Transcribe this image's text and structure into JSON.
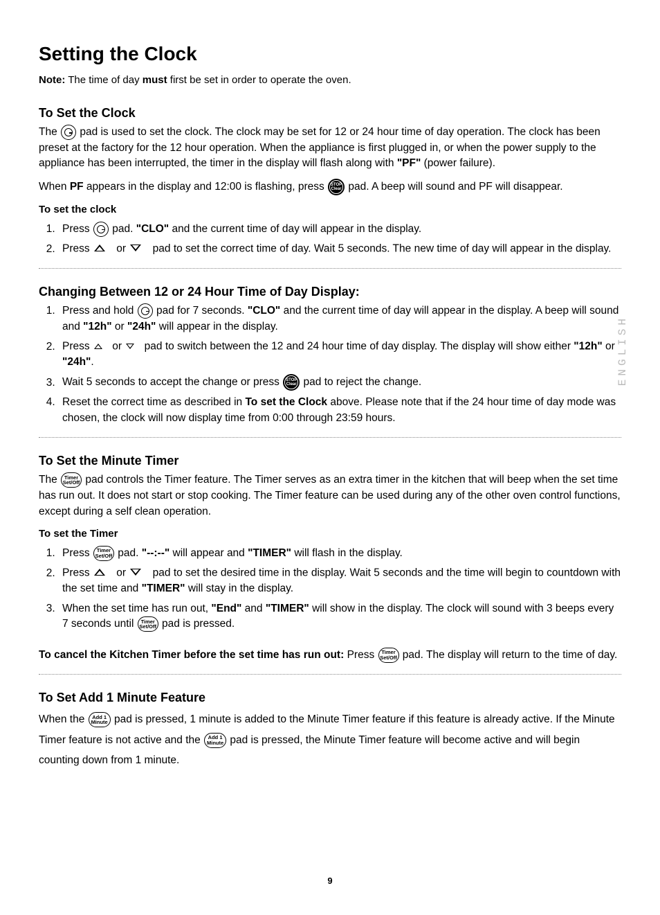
{
  "title": "Setting the Clock",
  "note_label": "Note:",
  "note_body_1": " The time of day ",
  "note_bold": "must",
  "note_body_2": " first be set in order to operate the oven.",
  "s1": {
    "heading": "To Set the Clock",
    "p1a": "The ",
    "p1b": " pad is used to set the clock. The clock may be set for 12 or 24 hour time of day operation. The clock has been preset at the factory for the 12 hour operation. When the appliance is first plugged in, or when the power supply to the appliance has been interrupted, the timer in the display will flash along with ",
    "p1c": "\"PF\"",
    "p1d": " (power failure).",
    "p2a": "When ",
    "p2b": "PF",
    "p2c": " appears in the display and 12:00 is flashing, press ",
    "p2d": " pad. A beep will sound and PF will disappear.",
    "sub": "To set the clock",
    "li1a": "Press ",
    "li1b": " pad. ",
    "li1c": "\"CLO\"",
    "li1d": " and the current time of day will appear in the display.",
    "li2a": "Press ",
    "li2b": " or ",
    "li2c": " pad to set the correct time of day. Wait 5 seconds. The new time of day will appear in the display."
  },
  "s2": {
    "heading": "Changing Between 12 or 24 Hour Time of Day Display:",
    "li1a": "Press and hold ",
    "li1b": " pad for 7 seconds. ",
    "li1c": "\"CLO\"",
    "li1d": " and the current time of day will appear in the display. A beep will sound and ",
    "li1e": "\"12h\"",
    "li1f": " or ",
    "li1g": "\"24h\"",
    "li1h": " will appear in the display.",
    "li2a": "Press ",
    "li2b": " or ",
    "li2c": " pad to switch between the 12 and 24 hour time of day display. The display will show either ",
    "li2d": "\"12h\"",
    "li2e": " or ",
    "li2f": "\"24h\"",
    "li2g": ".",
    "li3a": "Wait 5 seconds to accept the change or press ",
    "li3b": " pad to reject the change.",
    "li4a": "Reset the correct time as described in ",
    "li4b": "To set the Clock",
    "li4c": " above. Please note that if the 24 hour time of day mode was chosen, the clock will now display time from 0:00 through 23:59 hours."
  },
  "s3": {
    "heading": "To Set the Minute Timer",
    "p1a": "The ",
    "p1b": " pad controls the Timer feature. The Timer serves as an extra timer in the kitchen that will beep when the set time has run out. It does not start or stop cooking. The Timer feature can be used during any of the other oven control functions, except during a self clean operation.",
    "sub": "To set the Timer",
    "li1a": "Press ",
    "li1b": " pad. ",
    "li1c": "\"--:--\"",
    "li1d": " will appear and ",
    "li1e": "\"TIMER\"",
    "li1f": " will flash in the display.",
    "li2a": "Press ",
    "li2b": " or ",
    "li2c": " pad to set the desired time in the display. Wait 5 seconds and the time will begin to countdown with the set time and ",
    "li2d": "\"TIMER\"",
    "li2e": " will stay in the display.",
    "li3a": "When the set time has run out, ",
    "li3b": "\"End\"",
    "li3c": " and ",
    "li3d": "\"TIMER\"",
    "li3e": " will show in the display. The clock will sound with 3 beeps every 7 seconds until ",
    "li3f": " pad is pressed.",
    "cancel_a": "To cancel the Kitchen Timer before the set time has run out:",
    "cancel_b": " Press ",
    "cancel_c": " pad. The display will return to the time of day."
  },
  "s4": {
    "heading": "To Set Add 1 Minute Feature",
    "p1a": "When the ",
    "p1b": " pad is pressed, 1 minute is added to the Minute Timer feature if this feature is already active. If the Minute Timer feature is not active and the ",
    "p1c": " pad is pressed, the Minute Timer feature will become active and will begin counting down from 1 minute."
  },
  "icons": {
    "stop_top": "STOP",
    "stop_bot": "Clear",
    "timer_top": "Timer",
    "timer_bot": "Set/Off",
    "add1_top": "Add 1",
    "add1_bot": "Minute"
  },
  "side_tab": "ENGLISH",
  "page_num": "9"
}
